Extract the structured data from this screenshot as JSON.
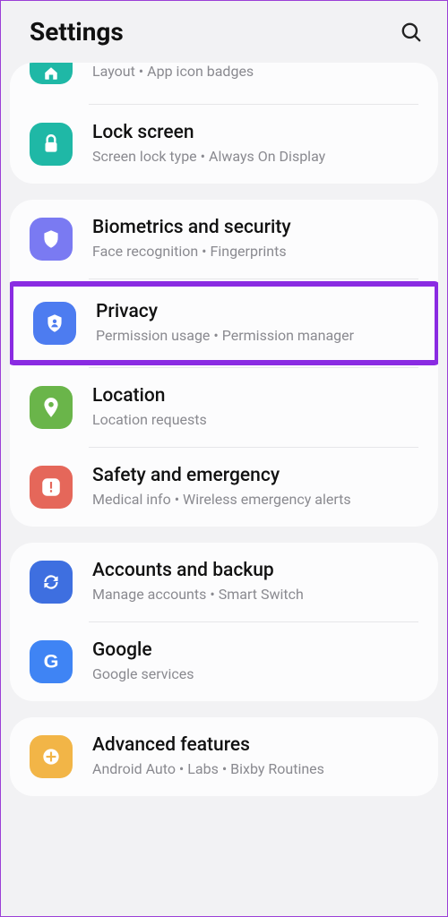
{
  "header": {
    "title": "Settings"
  },
  "groups": [
    {
      "items": [
        {
          "id": "home-screen",
          "cutTop": true,
          "iconColor": "c-teal",
          "icon": "home",
          "title": "",
          "sub": "Layout  •  App icon badges"
        },
        {
          "id": "lock-screen",
          "iconColor": "c-teal",
          "icon": "lock",
          "title": "Lock screen",
          "sub": "Screen lock type  •  Always On Display"
        }
      ]
    },
    {
      "items": [
        {
          "id": "biometrics",
          "iconColor": "c-indigo",
          "icon": "shield",
          "title": "Biometrics and security",
          "sub": "Face recognition  •  Fingerprints"
        },
        {
          "id": "privacy",
          "highlight": true,
          "iconColor": "c-blue",
          "icon": "privacy",
          "title": "Privacy",
          "sub": "Permission usage  •  Permission manager"
        },
        {
          "id": "location",
          "iconColor": "c-green",
          "icon": "pin",
          "title": "Location",
          "sub": "Location requests"
        },
        {
          "id": "safety",
          "iconColor": "c-red",
          "icon": "warn",
          "title": "Safety and emergency",
          "sub": "Medical info  •  Wireless emergency alerts"
        }
      ]
    },
    {
      "items": [
        {
          "id": "accounts",
          "iconColor": "c-blue2",
          "icon": "sync",
          "title": "Accounts and backup",
          "sub": "Manage accounts  •  Smart Switch"
        },
        {
          "id": "google",
          "iconColor": "c-gblue",
          "icon": "google",
          "title": "Google",
          "sub": "Google services"
        }
      ]
    },
    {
      "items": [
        {
          "id": "advanced",
          "iconColor": "c-amber",
          "icon": "plus",
          "title": "Advanced features",
          "sub": "Android Auto  •  Labs  •  Bixby Routines"
        }
      ]
    }
  ]
}
